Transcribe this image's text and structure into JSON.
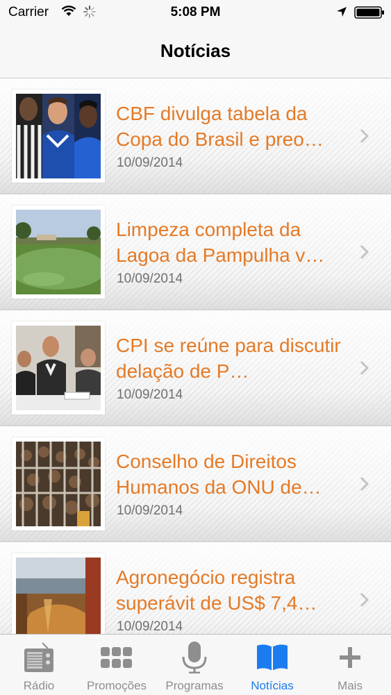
{
  "status_bar": {
    "carrier": "Carrier",
    "time": "5:08 PM",
    "icons": [
      "wifi-icon",
      "activity-spinner-icon",
      "location-arrow-icon",
      "battery-icon"
    ]
  },
  "nav": {
    "title": "Notícias"
  },
  "colors": {
    "accent": "#e57a26",
    "date": "#707070",
    "tab_active": "#1a7cf0",
    "tab_inactive": "#8e8e8e"
  },
  "news": [
    {
      "title": "CBF divulga tabela da Copa do Brasil e preo…",
      "date": "10/09/2014",
      "thumb": "football-players-photo"
    },
    {
      "title": "Limpeza completa da Lagoa da Pampulha v…",
      "date": "10/09/2014",
      "thumb": "lagoon-landscape-photo"
    },
    {
      "title": "CPI se reúne para discutir delação de P…",
      "date": "10/09/2014",
      "thumb": "meeting-photo"
    },
    {
      "title": "Conselho de Direitos Humanos da ONU de…",
      "date": "10/09/2014",
      "thumb": "prison-crowd-photo"
    },
    {
      "title": "Agronegócio registra superávit de US$ 7,4…",
      "date": "10/09/2014",
      "thumb": "grain-ship-photo"
    }
  ],
  "tabs": [
    {
      "label": "Rádio",
      "icon": "radio-icon"
    },
    {
      "label": "Promoções",
      "icon": "grid-icon"
    },
    {
      "label": "Programas",
      "icon": "microphone-icon"
    },
    {
      "label": "Notícias",
      "icon": "book-icon",
      "active": true
    },
    {
      "label": "Mais",
      "icon": "plus-icon"
    }
  ]
}
